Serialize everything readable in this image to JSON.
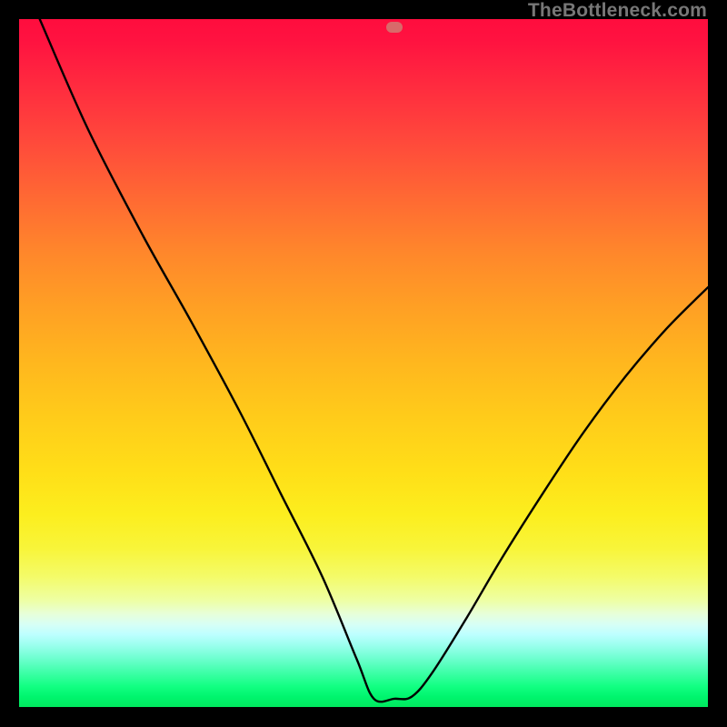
{
  "watermark": "TheBottleneck.com",
  "marker": {
    "x_pct": 54.5,
    "y_pct": 98.8
  },
  "chart_data": {
    "type": "line",
    "title": "",
    "xlabel": "",
    "ylabel": "",
    "xlim": [
      0,
      100
    ],
    "ylim": [
      0,
      100
    ],
    "series": [
      {
        "name": "bottleneck-curve",
        "points": [
          {
            "x": 3.0,
            "y": 100.0
          },
          {
            "x": 10.0,
            "y": 84.0
          },
          {
            "x": 18.0,
            "y": 68.5
          },
          {
            "x": 25.0,
            "y": 56.0
          },
          {
            "x": 32.0,
            "y": 43.0
          },
          {
            "x": 38.0,
            "y": 31.0
          },
          {
            "x": 44.0,
            "y": 19.0
          },
          {
            "x": 49.0,
            "y": 7.0
          },
          {
            "x": 51.5,
            "y": 1.2
          },
          {
            "x": 54.5,
            "y": 1.2
          },
          {
            "x": 57.0,
            "y": 1.5
          },
          {
            "x": 60.0,
            "y": 5.0
          },
          {
            "x": 65.0,
            "y": 13.0
          },
          {
            "x": 70.0,
            "y": 21.5
          },
          {
            "x": 76.0,
            "y": 31.0
          },
          {
            "x": 82.0,
            "y": 40.0
          },
          {
            "x": 88.0,
            "y": 48.0
          },
          {
            "x": 94.0,
            "y": 55.0
          },
          {
            "x": 100.0,
            "y": 61.0
          }
        ]
      }
    ],
    "background_gradient": {
      "top": "#ff0d3e",
      "mid": "#ffe018",
      "bottom": "#00e85e"
    },
    "marker": {
      "x": 54.5,
      "y": 1.2,
      "color": "#d86a6a"
    }
  }
}
